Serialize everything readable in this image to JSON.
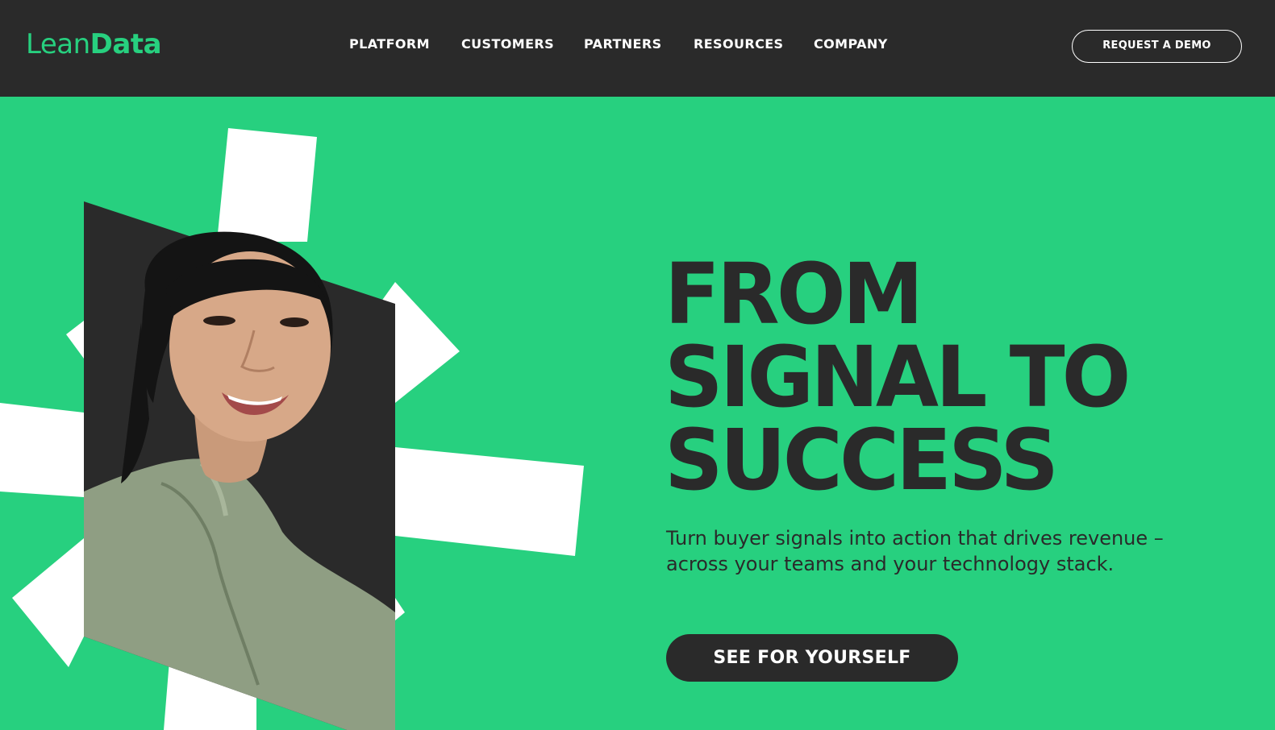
{
  "header": {
    "logo": {
      "part1": "Lean",
      "part2": "Data"
    },
    "nav": [
      {
        "label": "PLATFORM"
      },
      {
        "label": "CUSTOMERS"
      },
      {
        "label": "PARTNERS"
      },
      {
        "label": "RESOURCES"
      },
      {
        "label": "COMPANY"
      }
    ],
    "cta_label": "REQUEST A DEMO"
  },
  "hero": {
    "title_lines": [
      "FROM",
      "SIGNAL TO",
      "SUCCESS"
    ],
    "subtitle_line1": "Turn buyer signals into action that drives revenue –",
    "subtitle_line2": "across your teams and your technology stack.",
    "cta_label": "SEE FOR YOURSELF"
  },
  "colors": {
    "brand_green": "#27d07f",
    "dark": "#2a2a2a",
    "white": "#ffffff"
  }
}
